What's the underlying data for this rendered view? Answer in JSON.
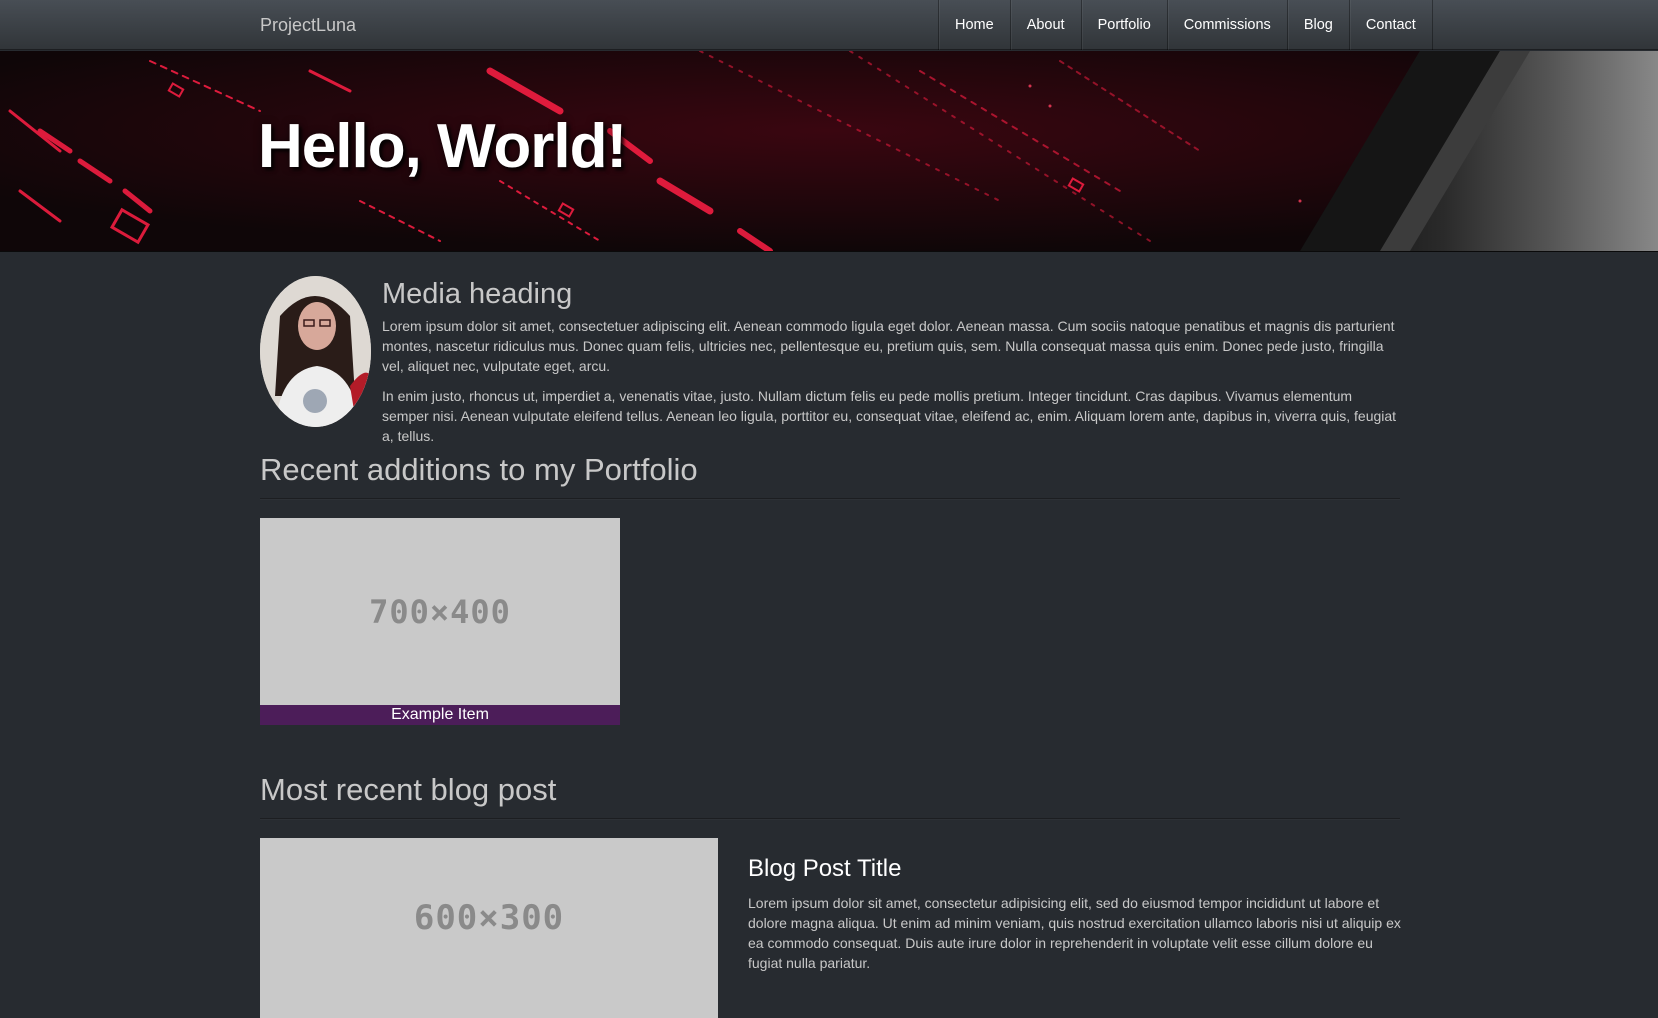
{
  "nav": {
    "brand": "ProjectLuna",
    "items": [
      "Home",
      "About",
      "Portfolio",
      "Commissions",
      "Blog",
      "Contact"
    ]
  },
  "hero": {
    "title": "Hello, World!"
  },
  "media": {
    "heading": "Media heading",
    "paragraphs": [
      "Lorem ipsum dolor sit amet, consectetuer adipiscing elit. Aenean commodo ligula eget dolor. Aenean massa. Cum sociis natoque penatibus et magnis dis parturient montes, nascetur ridiculus mus. Donec quam felis, ultricies nec, pellentesque eu, pretium quis, sem. Nulla consequat massa quis enim. Donec pede justo, fringilla vel, aliquet nec, vulputate eget, arcu.",
      "In enim justo, rhoncus ut, imperdiet a, venenatis vitae, justo. Nullam dictum felis eu pede mollis pretium. Integer tincidunt. Cras dapibus. Vivamus elementum semper nisi. Aenean vulputate eleifend tellus. Aenean leo ligula, porttitor eu, consequat vitae, eleifend ac, enim. Aliquam lorem ante, dapibus in, viverra quis, feugiat a, tellus."
    ]
  },
  "portfolio": {
    "heading": "Recent additions to my Portfolio",
    "item": {
      "placeholder": "700×400",
      "caption": "Example Item"
    }
  },
  "blog": {
    "heading": "Most recent blog post",
    "placeholder": "600×300",
    "post_title": "Blog Post Title",
    "post_text": "Lorem ipsum dolor sit amet, consectetur adipisicing elit, sed do eiusmod tempor incididunt ut labore et dolore magna aliqua. Ut enim ad minim veniam, quis nostrud exercitation ullamco laboris nisi ut aliquip ex ea commodo consequat. Duis aute irure dolor in reprehenderit in voluptate velit esse cillum dolore eu fugiat nulla pariatur."
  },
  "colors": {
    "background": "#272b30",
    "navbar": "#3a3f44",
    "caption_bg": "#4c1d59",
    "placeholder_bg": "#c9c9c9",
    "hero_accent": "#ff2a4a"
  }
}
